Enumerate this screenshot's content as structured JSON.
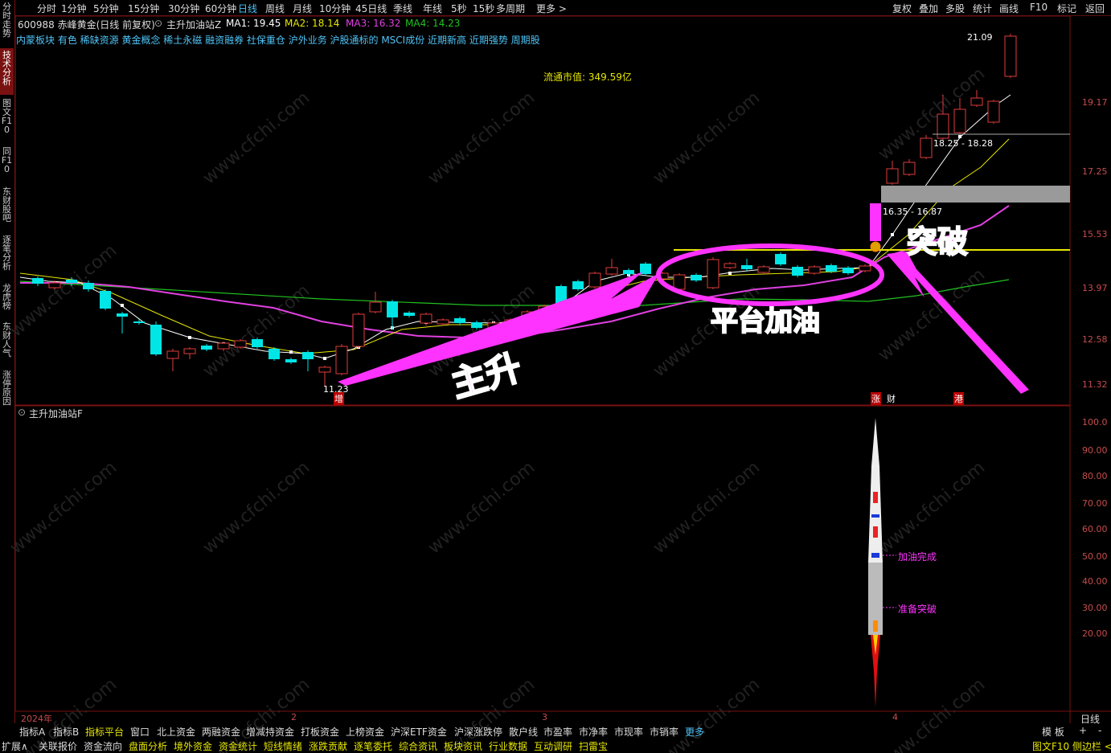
{
  "sidebar": {
    "items": [
      {
        "label": "分时走势"
      },
      {
        "label": "技术分析"
      },
      {
        "label": "图文F10"
      },
      {
        "label": "同F10"
      },
      {
        "label": "东财股吧"
      },
      {
        "label": "逐笔分析"
      },
      {
        "label": "龙虎榜"
      },
      {
        "label": "东财人气"
      },
      {
        "label": "涨停原因"
      }
    ]
  },
  "toolbar": {
    "periods": [
      "分时",
      "1分钟",
      "5分钟",
      "15分钟",
      "30分钟",
      "60分钟",
      "日线",
      "周线",
      "月线",
      "10分钟",
      "45日线",
      "季线",
      "年线",
      "5秒",
      "15秒",
      "多周期",
      "更多"
    ],
    "selected_period": "日线",
    "right_items": [
      "复权",
      "叠加",
      "多股",
      "统计",
      "画线",
      "F10",
      "标记",
      "返回"
    ]
  },
  "stock": {
    "code_name": "600988 赤峰黄金(日线 前复权)",
    "indicator": "主升加油站Z",
    "ma1": "MA1: 19.45",
    "ma2": "MA2: 18.14",
    "ma3": "MA3: 16.32",
    "ma4": "MA4: 14.23",
    "concepts": "内蒙板块 有色 稀缺资源 黄金概念 稀土永磁 融资融券 社保重仓 沪外业务 沪股通标的 MSCI成份 近期新高 近期强势 周期股",
    "float_cap": "流通市值: 349.59亿"
  },
  "colors": {
    "up": "#e03c3c",
    "down": "#00e5e5",
    "ma1": "#ffffff",
    "ma2": "#e6e600",
    "ma3": "#e040e0",
    "ma4": "#20c020",
    "annot": "#ff33ff"
  },
  "price_axis": [
    "19.17",
    "17.25",
    "15.53",
    "13.97",
    "12.58",
    "11.32"
  ],
  "price_labels": {
    "high": "21.09",
    "low": "11.23",
    "zone1": "18.25 - 18.28",
    "zone2": "16.35 - 16.87"
  },
  "markers": {
    "zeng": "增",
    "zhang": "涨",
    "cai": "财",
    "gang": "港"
  },
  "annotations": {
    "main_rise": "主升",
    "platform": "平台加油",
    "breakout": "突破"
  },
  "lower_panel": {
    "title": "主升加油站F",
    "axis": [
      "100.0",
      "90.00",
      "80.00",
      "70.00",
      "60.00",
      "50.00",
      "40.00",
      "30.00",
      "20.00"
    ],
    "label_done": "加油完成",
    "label_ready": "准备突破",
    "fuel_done_level": 50,
    "ready_level": 30
  },
  "time_axis": {
    "year": "2024年",
    "m2": "2",
    "m3": "3",
    "m4": "4",
    "period": "日线"
  },
  "bottom_tabs_row1": [
    "指标A",
    "指标B",
    "指标平台",
    "窗口",
    "北上资金",
    "两融资金",
    "增减持资金",
    "打板资金",
    "上榜资金",
    "沪深ETF资金",
    "沪深涨跌停",
    "散户线",
    "市盈率",
    "市净率",
    "市现率",
    "市销率",
    "更多"
  ],
  "bottom_tabs_row1_right": [
    "模 板",
    "+",
    "-"
  ],
  "bottom_tabs_row2": [
    "扩展∧",
    "关联报价",
    "资金流向",
    "盘面分析",
    "境外资金",
    "资金统计",
    "短线情绪",
    "涨跌贡献",
    "逐笔委托",
    "综合资讯",
    "板块资讯",
    "行业数据",
    "互动调研",
    "扫雷宝"
  ],
  "bottom_right": "图文F10 侧边栏 <",
  "watermark": "www.cfchi.com"
}
